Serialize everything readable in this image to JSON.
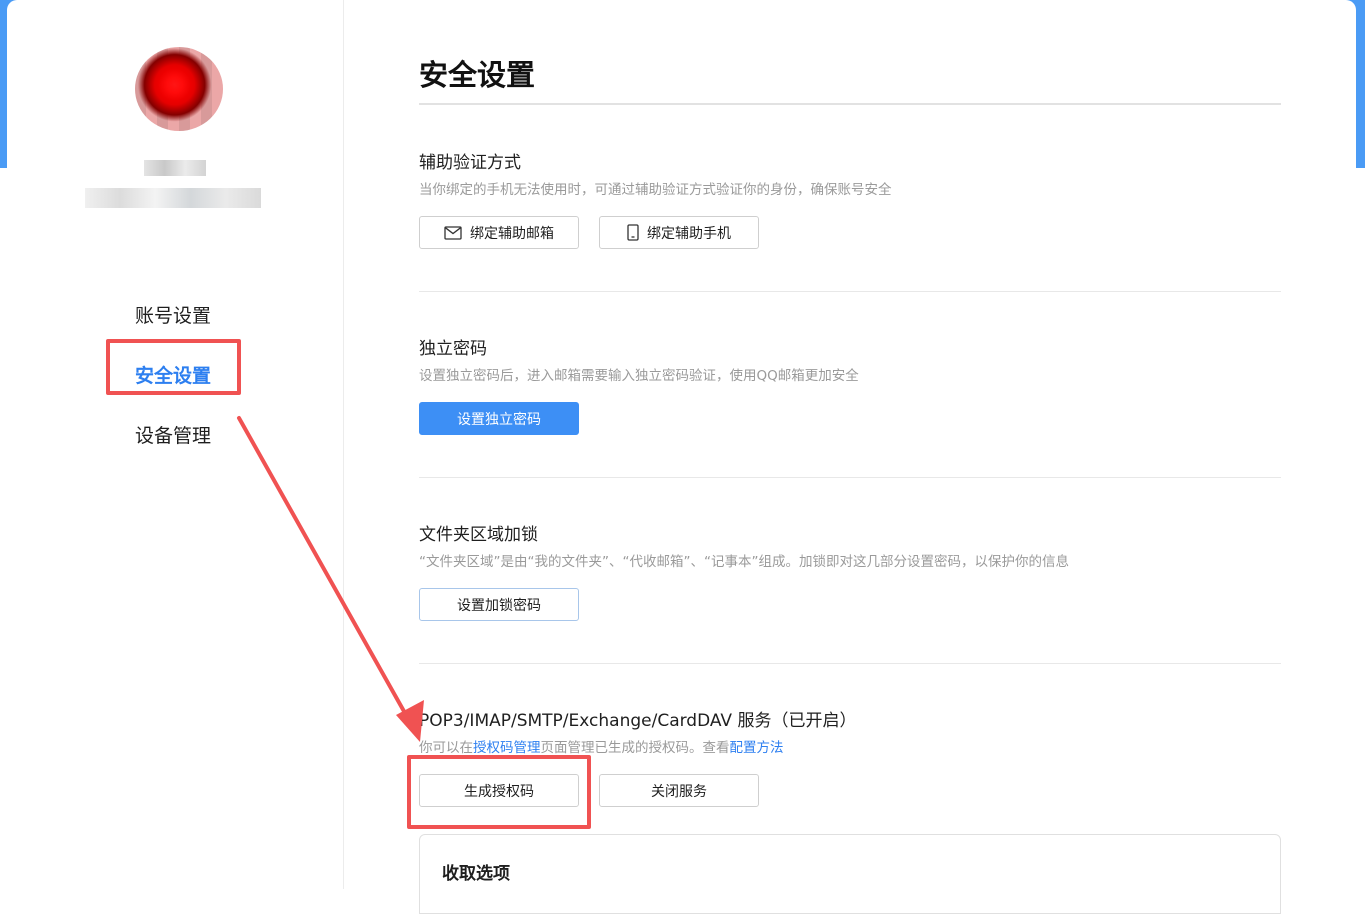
{
  "sidebar": {
    "items": [
      {
        "label": "账号设置"
      },
      {
        "label": "安全设置"
      },
      {
        "label": "设备管理"
      }
    ]
  },
  "main": {
    "page_title": "安全设置",
    "sections": {
      "aux_verify": {
        "title": "辅助验证方式",
        "desc": "当你绑定的手机无法使用时，可通过辅助验证方式验证你的身份，确保账号安全",
        "bind_email_label": "绑定辅助邮箱",
        "bind_phone_label": "绑定辅助手机"
      },
      "independent_password": {
        "title": "独立密码",
        "desc": "设置独立密码后，进入邮箱需要输入独立密码验证，使用QQ邮箱更加安全",
        "button_label": "设置独立密码"
      },
      "folder_lock": {
        "title": "文件夹区域加锁",
        "desc": "“文件夹区域”是由“我的文件夹”、“代收邮箱”、“记事本”组成。加锁即对这几部分设置密码，以保护你的信息",
        "button_label": "设置加锁密码"
      },
      "pop3_service": {
        "title": "POP3/IMAP/SMTP/Exchange/CardDAV 服务（已开启）",
        "desc_prefix": "你可以在",
        "desc_link1": "授权码管理",
        "desc_middle": "页面管理已生成的授权码。查看",
        "desc_link2": "配置方法",
        "generate_label": "生成授权码",
        "close_label": "关闭服务"
      },
      "fetch_options": {
        "title": "收取选项"
      }
    }
  },
  "colors": {
    "accent": "#2d7ff0",
    "primary_button": "#3d8ff5",
    "highlight_annotation": "#f05252",
    "header_blue": "#4a9bf5"
  }
}
